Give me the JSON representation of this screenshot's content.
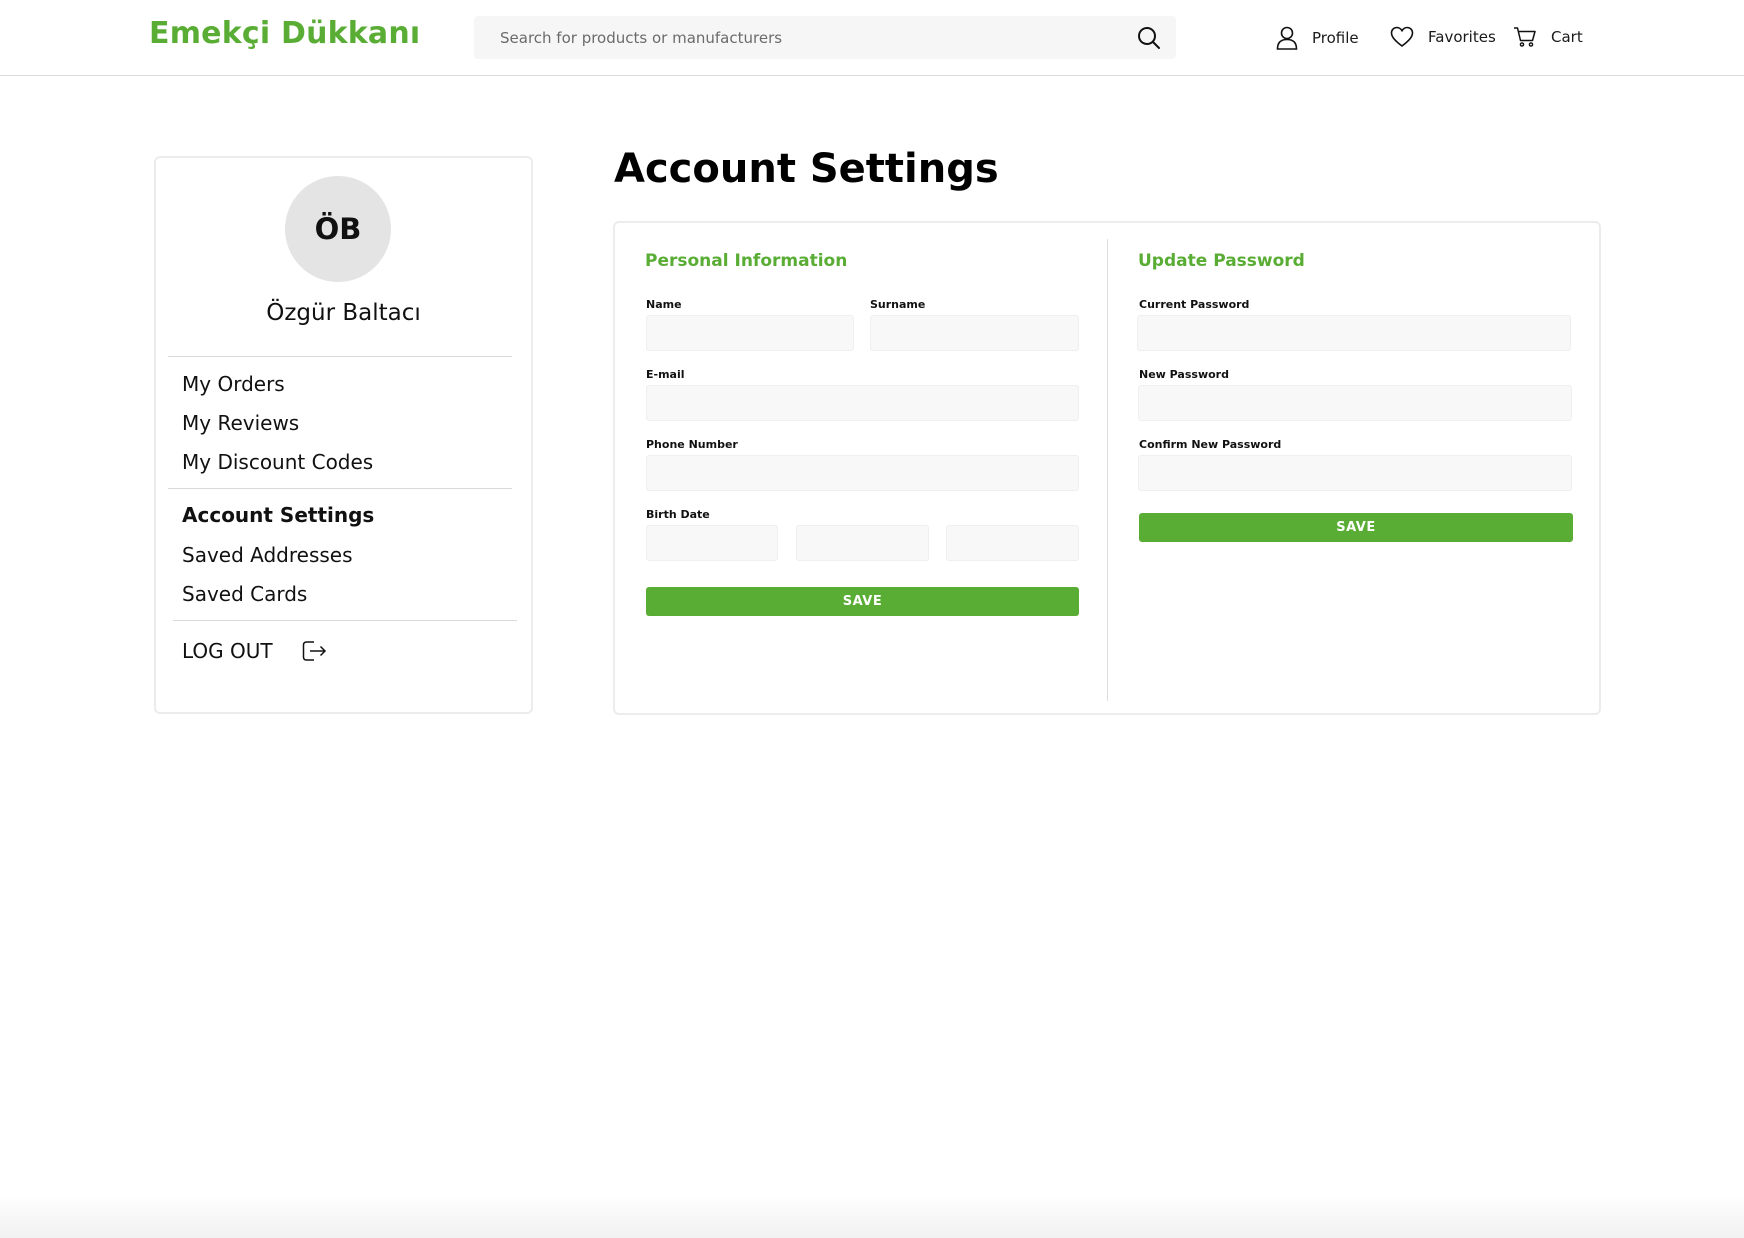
{
  "header": {
    "logo": "Emekçi Dükkanı",
    "search_placeholder": "Search for products or manufacturers",
    "nav": {
      "profile": "Profile",
      "favorites": "Favorites",
      "cart": "Cart"
    }
  },
  "sidebar": {
    "initials": "ÖB",
    "user_name": "Özgür Baltacı",
    "group1": [
      "My Orders",
      "My Reviews",
      "My Discount Codes"
    ],
    "group2": [
      "Account Settings",
      "Saved Addresses",
      "Saved Cards"
    ],
    "active_item": "Account Settings",
    "logout": "LOG OUT"
  },
  "main": {
    "title": "Account Settings",
    "personal": {
      "title": "Personal Information",
      "name_label": "Name",
      "surname_label": "Surname",
      "email_label": "E-mail",
      "phone_label": "Phone Number",
      "birth_label": "Birth Date",
      "values": {
        "name": "",
        "surname": "",
        "email": "",
        "phone": "",
        "birth_day": "",
        "birth_month": "",
        "birth_year": ""
      },
      "save": "SAVE"
    },
    "password": {
      "title": "Update Password",
      "current_label": "Current Password",
      "new_label": "New Password",
      "confirm_label": "Confirm New Password",
      "save": "SAVE"
    }
  },
  "colors": {
    "brand": "#5aad34",
    "field_bg": "#f8f8f8",
    "avatar_bg": "#e4e4e4"
  }
}
